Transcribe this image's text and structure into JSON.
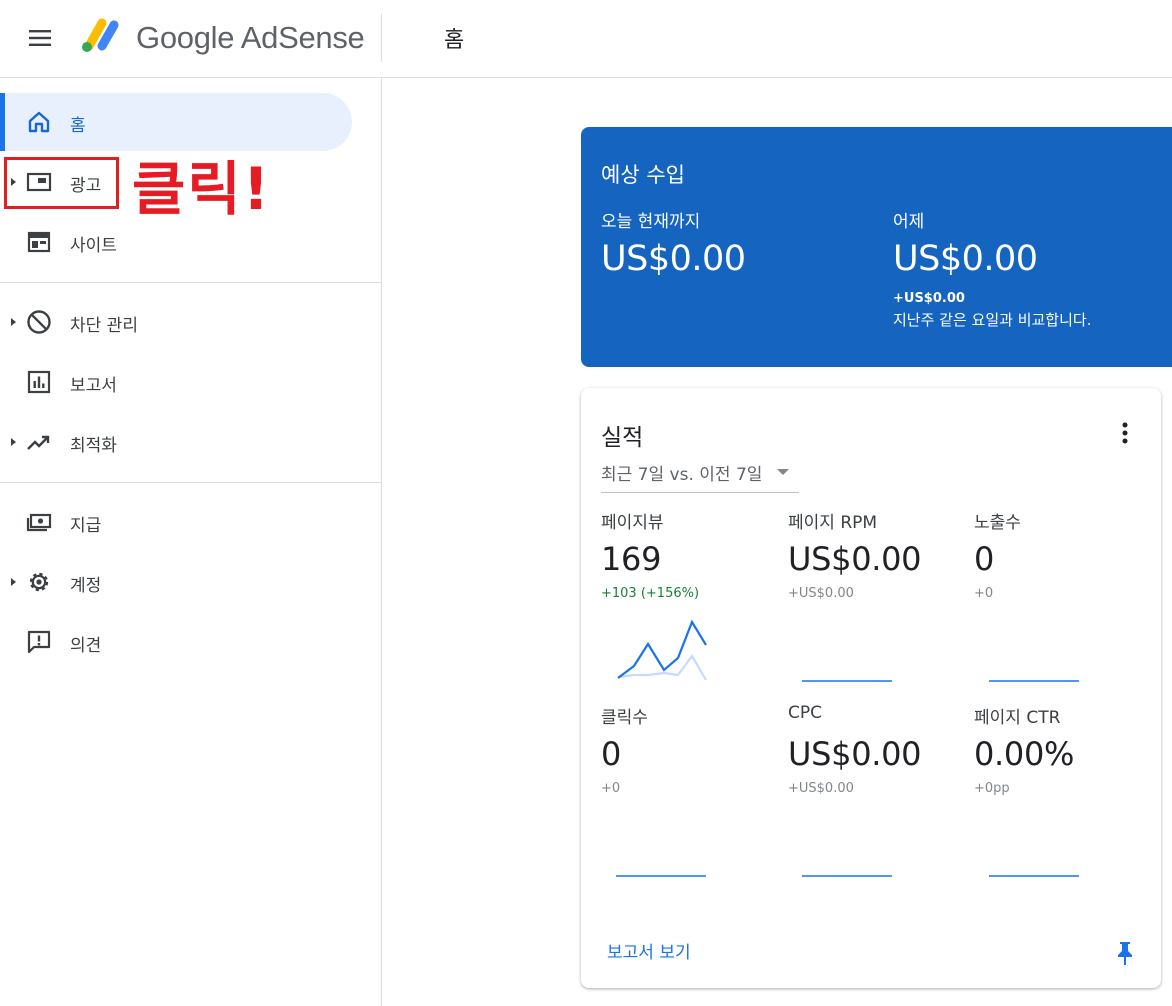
{
  "header": {
    "logo_text": "Google AdSense",
    "page_title": "홈"
  },
  "sidebar": {
    "items": [
      {
        "label": "홈",
        "icon": "home-icon"
      },
      {
        "label": "광고",
        "icon": "ads-icon"
      },
      {
        "label": "사이트",
        "icon": "sites-icon"
      },
      {
        "label": "차단 관리",
        "icon": "block-icon"
      },
      {
        "label": "보고서",
        "icon": "report-icon"
      },
      {
        "label": "최적화",
        "icon": "trending-up-icon"
      },
      {
        "label": "지급",
        "icon": "payments-icon"
      },
      {
        "label": "계정",
        "icon": "settings-gear-icon"
      },
      {
        "label": "의견",
        "icon": "feedback-icon"
      }
    ]
  },
  "annotation": {
    "text": "클릭!",
    "color": "#e51c23"
  },
  "revenue": {
    "title": "예상 수입",
    "today_label": "오늘 현재까지",
    "today_value": "US$0.00",
    "yesterday_label": "어제",
    "yesterday_value": "US$0.00",
    "yesterday_delta": "+US$0.00",
    "compare_text": "지난주 같은 요일과 비교합니다.",
    "bg_color": "#1565c0"
  },
  "performance": {
    "title": "실적",
    "period": "최근 7일 vs. 이전 7일",
    "metrics": [
      {
        "label": "페이지뷰",
        "value": "169",
        "delta": "+103 (+156%)"
      },
      {
        "label": "페이지 RPM",
        "value": "US$0.00",
        "delta": "+US$0.00"
      },
      {
        "label": "노출수",
        "value": "0",
        "delta": "+0"
      },
      {
        "label": "클릭수",
        "value": "0",
        "delta": "+0"
      },
      {
        "label": "CPC",
        "value": "US$0.00",
        "delta": "+US$0.00"
      },
      {
        "label": "페이지 CTR",
        "value": "0.00%",
        "delta": "+0pp"
      }
    ],
    "report_link": "보고서 보기",
    "accent_color": "#1a73e8",
    "positive_color": "#188038"
  }
}
